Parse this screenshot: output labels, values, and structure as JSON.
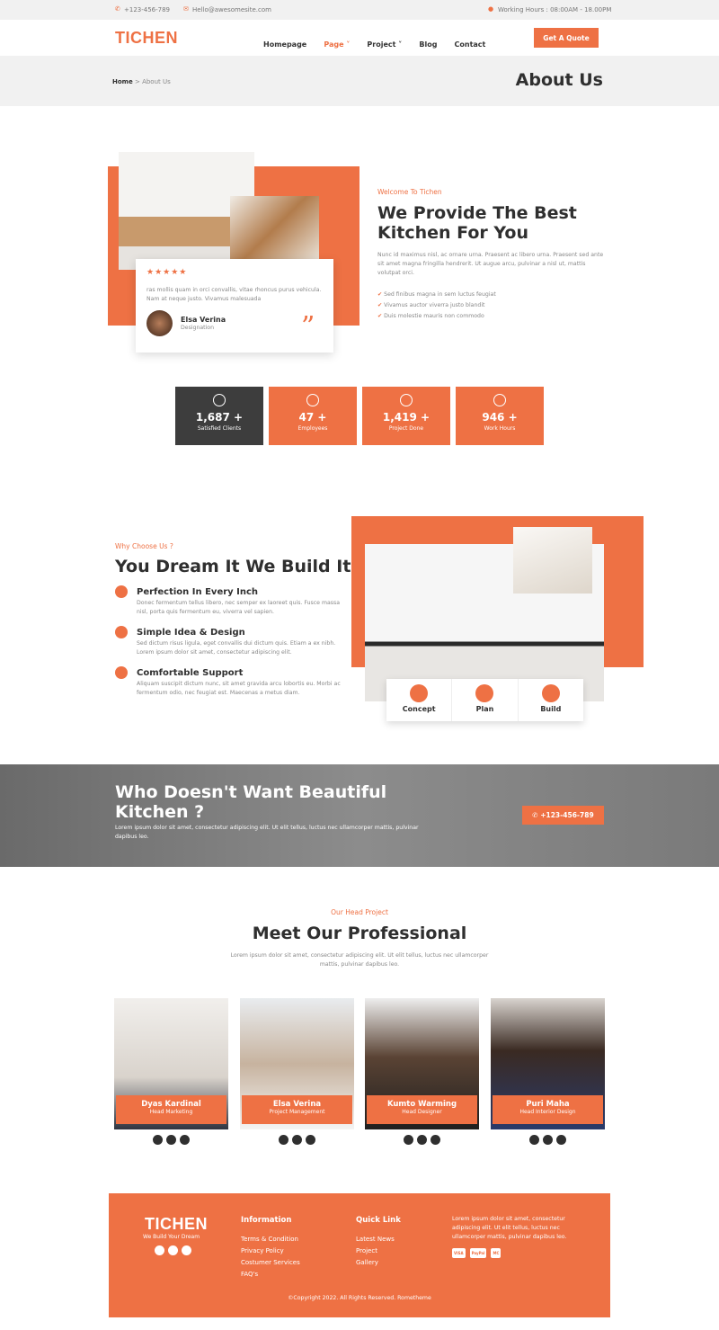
{
  "topbar": {
    "phone": "+123-456-789",
    "email": "Hello@awesomesite.com",
    "hours": "Working Hours :  08:00AM - 18.00PM"
  },
  "nav": {
    "logo": "TICHEN",
    "items": [
      "Homepage",
      "Page",
      "Project",
      "Blog",
      "Contact"
    ],
    "active": "Page",
    "cta": "Get A Quote"
  },
  "page_header": {
    "breadcrumb_home": "Home",
    "breadcrumb_sep": ">",
    "breadcrumb_current": "About Us",
    "title": "About Us"
  },
  "about": {
    "label": "Welcome To Tichen",
    "heading_1": "We Provide The Best",
    "heading_2": "Kitchen For You",
    "paragraph": "Nunc id maximus nisl, ac ornare urna. Praesent ac libero urna. Praesent sed ante sit amet magna fringilla hendrerit. Ut augue arcu, pulvinar a nisl ut, mattis volutpat orci.",
    "list": [
      "Sed finibus magna in sem luctus feugiat",
      "Vivamus auctor viverra justo blandit",
      "Duis molestie mauris non commodo"
    ],
    "testimonial": {
      "stars": 5,
      "text": "ras mollis quam in orci convallis, vitae rhoncus purus vehicula. Nam at neque justo. Vivamus malesuada",
      "name": "Elsa Verina",
      "role": "Designation"
    }
  },
  "stats": [
    {
      "value": "1,687 +",
      "label": "Satisfied Clients",
      "icon": "handshake-icon"
    },
    {
      "value": "47 +",
      "label": "Employees",
      "icon": "users-icon"
    },
    {
      "value": "1,419 +",
      "label": "Project Done",
      "icon": "check-badge-icon"
    },
    {
      "value": "946 +",
      "label": "Work Hours",
      "icon": "clock-icon"
    }
  ],
  "why": {
    "label": "Why Choose Us ?",
    "heading": "You Dream It We Build It",
    "features": [
      {
        "title": "Perfection In Every Inch",
        "text": "Donec fermentum tellus libero, nec semper ex laoreet quis. Fusce massa nisl, porta quis fermentum eu, viverra vel sapien."
      },
      {
        "title": "Simple Idea & Design",
        "text": "Sed dictum risus ligula, eget convallis dui dictum quis. Etiam a ex nibh. Lorem ipsum dolor sit amet, consectetur adipiscing elit."
      },
      {
        "title": "Comfortable Support",
        "text": "Aliquam suscipit dictum nunc, sit amet gravida arcu lobortis eu. Morbi ac fermentum odio, nec feugiat est. Maecenas a metus diam."
      }
    ],
    "tabs": [
      "Concept",
      "Plan",
      "Build"
    ]
  },
  "banner": {
    "heading_1": "Who Doesn't Want Beautiful",
    "heading_2": "Kitchen ?",
    "text": "Lorem ipsum dolor sit amet, consectetur adipiscing elit. Ut elit tellus, luctus nec ullamcorper mattis, pulvinar dapibus leo.",
    "phone": "+123-456-789"
  },
  "team": {
    "label": "Our Head Project",
    "heading": "Meet Our Professional",
    "text": "Lorem ipsum dolor sit amet, consectetur adipiscing elit. Ut elit tellus, luctus nec ullamcorper mattis, pulvinar dapibus leo.",
    "members": [
      {
        "name": "Dyas Kardinal",
        "role": "Head Marketing"
      },
      {
        "name": "Elsa Verina",
        "role": "Project Management"
      },
      {
        "name": "Kumto Warming",
        "role": "Head Designer"
      },
      {
        "name": "Puri Maha",
        "role": "Head Interior Design"
      }
    ]
  },
  "footer": {
    "logo": "TICHEN",
    "tagline": "We Build Your Dream",
    "info_title": "Information",
    "info_links": [
      "Terms & Condition",
      "Privacy Policy",
      "Costumer Services",
      "FAQ's"
    ],
    "quick_title": "Quick Link",
    "quick_links": [
      "Latest News",
      "Project",
      "Gallery"
    ],
    "about": "Lorem ipsum dolor sit amet, consectetur adipiscing elit. Ut elit tellus, luctus nec ullamcorper mattis, pulvinar dapibus leo.",
    "payments": [
      "VISA",
      "PayPal",
      "MC"
    ],
    "copyright": "©Copyright 2022. All Rights Reserved. Rometheme"
  },
  "colors": {
    "accent": "#ee7144",
    "dark": "#3d3d3d"
  }
}
